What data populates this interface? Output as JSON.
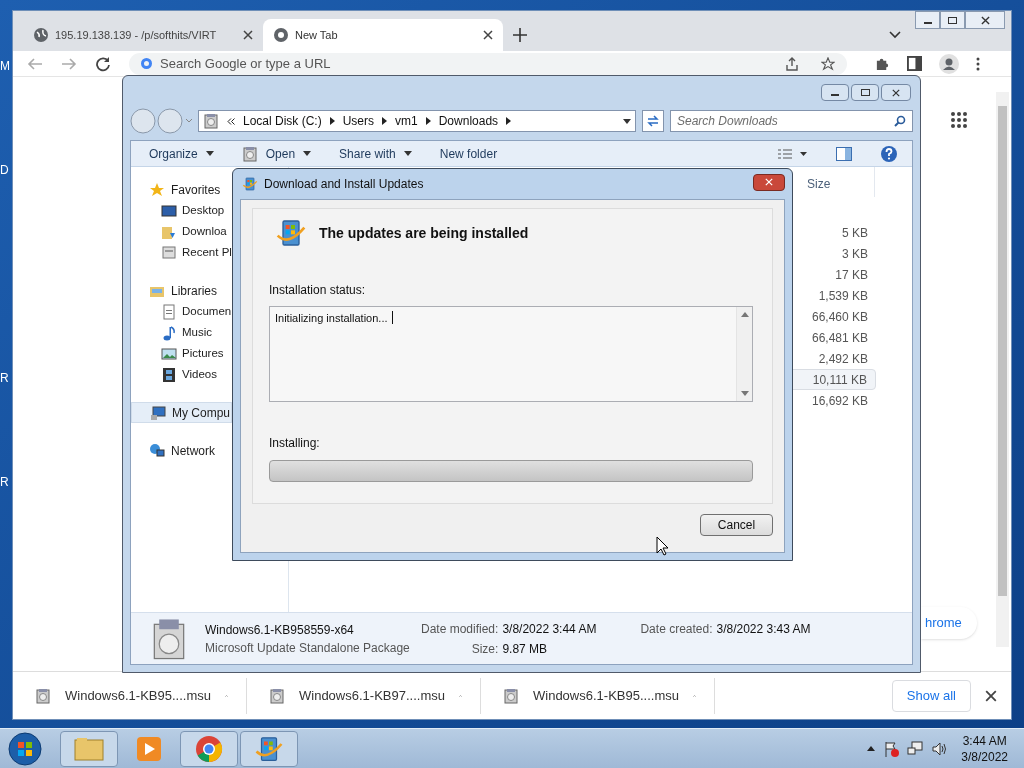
{
  "desktop": {
    "icon_labels": [
      "M",
      "D",
      "R",
      "R"
    ]
  },
  "browser": {
    "tabs": [
      {
        "title": "195.19.138.139 - /p/softhits/VIRT",
        "selected": false
      },
      {
        "title": "New Tab",
        "selected": true
      }
    ],
    "omnibox": {
      "placeholder": "Search Google or type a URL"
    },
    "page_button": "hrome",
    "downloads": [
      {
        "name": "Windows6.1-KB95....msu"
      },
      {
        "name": "Windows6.1-KB97....msu"
      },
      {
        "name": "Windows6.1-KB95....msu"
      }
    ],
    "show_all": "Show all"
  },
  "explorer": {
    "breadcrumb": [
      "Local Disk (C:)",
      "Users",
      "vm1",
      "Downloads"
    ],
    "search": {
      "placeholder": "Search Downloads"
    },
    "toolbar": [
      {
        "label": "Organize",
        "dropdown": true
      },
      {
        "label": "Open",
        "dropdown": true
      },
      {
        "label": "Share with",
        "dropdown": true
      },
      {
        "label": "New folder",
        "dropdown": false
      }
    ],
    "nav": [
      {
        "label": "Favorites",
        "selected": false,
        "children": [
          {
            "label": "Desktop",
            "selected": false
          },
          {
            "label": "Downloa",
            "selected": false
          },
          {
            "label": "Recent Pl",
            "selected": false
          }
        ]
      },
      {
        "label": "Libraries",
        "selected": false,
        "children": [
          {
            "label": "Documen",
            "selected": false
          },
          {
            "label": "Music",
            "selected": false
          },
          {
            "label": "Pictures",
            "selected": false
          },
          {
            "label": "Videos",
            "selected": false
          }
        ]
      },
      {
        "label": "My Compu",
        "selected": true
      },
      {
        "label": "Network",
        "selected": false
      }
    ],
    "columns": [
      "Size"
    ],
    "rows": [
      {
        "size": "5 KB",
        "selected": false
      },
      {
        "size": "3 KB",
        "selected": false
      },
      {
        "size": "17 KB",
        "selected": false
      },
      {
        "size": "1,539 KB",
        "selected": false
      },
      {
        "size": "66,460 KB",
        "selected": false
      },
      {
        "size": "66,481 KB",
        "selected": false
      },
      {
        "size": "2,492 KB",
        "selected": false
      },
      {
        "size": "10,111 KB",
        "selected": true
      },
      {
        "size": "16,692 KB",
        "selected": false
      }
    ],
    "details": {
      "name": "Windows6.1-KB958559-x64",
      "type": "Microsoft Update Standalone Package",
      "fields": [
        {
          "label": "Date modified:",
          "value": "3/8/2022 3:44 AM"
        },
        {
          "label": "Date created:",
          "value": "3/8/2022 3:43 AM"
        },
        {
          "label": "Size:",
          "value": "9.87 MB"
        }
      ]
    }
  },
  "dialog": {
    "title": "Download and Install Updates",
    "heading": "The updates are being installed",
    "status_label": "Installation status:",
    "status_text": "Initializing installation...",
    "progress_label": "Installing:",
    "progress": {
      "level": 0
    },
    "cancel": "Cancel"
  },
  "taskbar": {
    "time": "3:44 AM",
    "date": "3/8/2022"
  }
}
